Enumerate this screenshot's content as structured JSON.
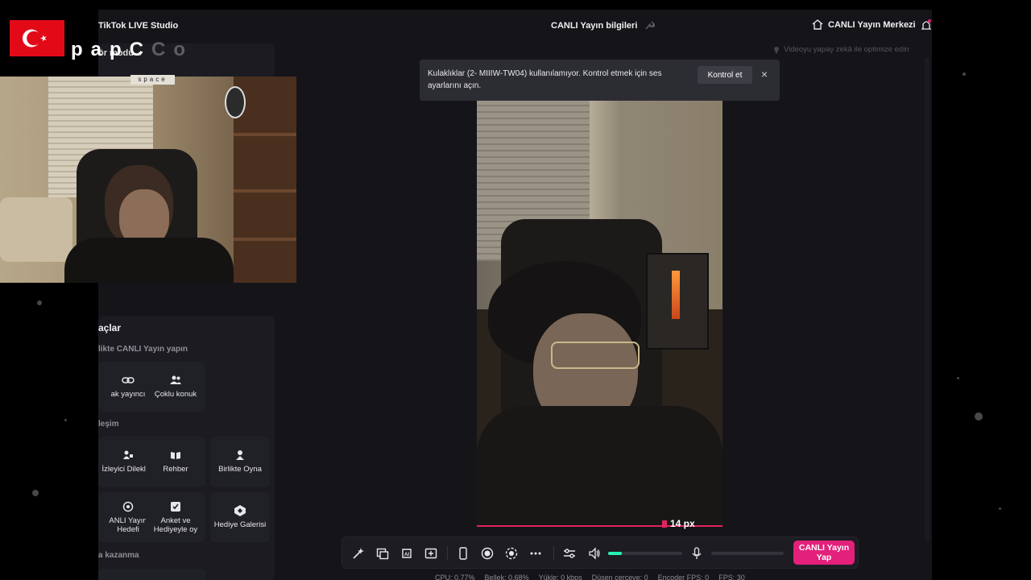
{
  "app": {
    "title": "TikTok LIVE Studio",
    "live_info": "CANLI Yayın bilgileri",
    "live_center": "CANLI Yayın Merkezi"
  },
  "overlay": {
    "letters": "papC",
    "letters_faint": "Co",
    "space_key": "space"
  },
  "left_panel": {
    "mode_label": "ör modu",
    "section_title": "açlar",
    "groups": [
      {
        "title": "likte CANLI Yayın yapın",
        "tiles": [
          {
            "label": "ak yayıncı",
            "icon": "link-icon"
          },
          {
            "label": "Çoklu konuk",
            "icon": "users-icon"
          }
        ]
      },
      {
        "title": "leşim",
        "tiles": [
          {
            "label": "İzleyici Dilekleri",
            "icon": "wishes-icon"
          },
          {
            "label": "Rehber",
            "icon": "guide-icon"
          },
          {
            "label": "Birlikte Oyna",
            "icon": "play-together-icon"
          }
        ]
      },
      {
        "title": "",
        "tiles": [
          {
            "label": "ANLI Yayın Hedefi",
            "icon": "target-icon"
          },
          {
            "label": "Anket ve Hediyeyle oy",
            "icon": "poll-icon"
          },
          {
            "label": "Hediye Galerisi",
            "icon": "gift-gallery-icon"
          }
        ]
      }
    ],
    "earn_title": "a kazanma"
  },
  "notice": {
    "text": "Kulaklıklar (2- MIIIW-TW04) kullanılamıyor. Kontrol etmek için ses ayarlarını açın.",
    "button": "Kontrol et",
    "close": "×"
  },
  "preview": {
    "optimize_hint": "Videoyu yapay zekâ ile optimize edin",
    "size_label": "14 px"
  },
  "toolbar": {
    "go_live": "CANLI Yayın Yap",
    "speaker_level": 0.18,
    "mic_level": 0.0,
    "accent": "#25f4b4",
    "live_color": "#e3207a"
  },
  "stats": {
    "cpu": "CPU: 0.77%",
    "memory": "Bellek: 0.68%",
    "upload": "Yükle: 0 kbps",
    "dropped": "Düşen çerçeve: 0",
    "encoder_fps": "Encoder FPS: 0",
    "fps": "FPS: 30"
  }
}
